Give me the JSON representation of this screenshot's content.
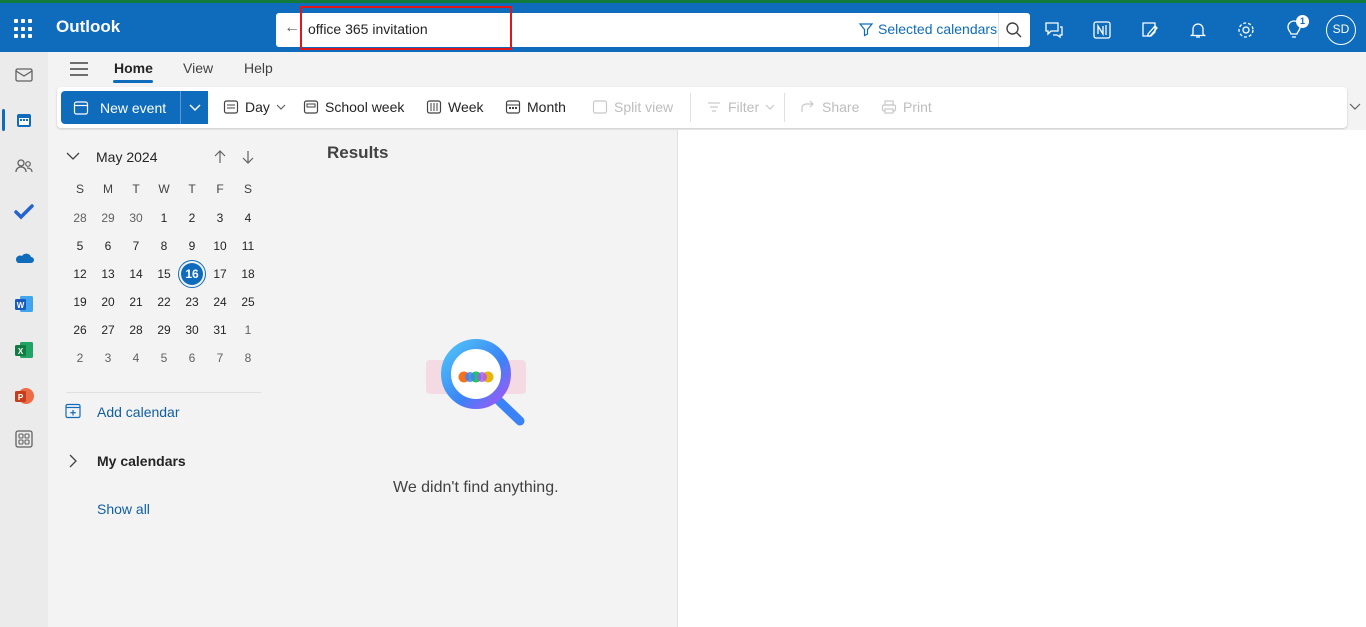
{
  "app": {
    "name": "Outlook",
    "brand_color": "#0f6cbd"
  },
  "search": {
    "query": "office 365 invitation",
    "scope": "Selected calendars"
  },
  "header": {
    "notification_count": "1",
    "avatar_initials": "SD",
    "icons": [
      "chat-icon",
      "onenote-icon",
      "todo-icon",
      "bell-icon",
      "gear-icon",
      "lightbulb-icon"
    ]
  },
  "rail": {
    "items": [
      "mail-icon",
      "calendar-icon",
      "people-icon",
      "todo-check-icon",
      "onedrive-icon",
      "word-icon",
      "excel-icon",
      "powerpoint-icon",
      "apps-icon"
    ]
  },
  "ribbon": {
    "tabs": [
      "Home",
      "View",
      "Help"
    ],
    "active_tab": "Home"
  },
  "commands": {
    "new_event": "New event",
    "day": "Day",
    "school_week": "School week",
    "week": "Week",
    "month": "Month",
    "split_view": "Split view",
    "filter": "Filter",
    "share": "Share",
    "print": "Print"
  },
  "mini_calendar": {
    "month_label": "May 2024",
    "weekdays": [
      "S",
      "M",
      "T",
      "W",
      "T",
      "F",
      "S"
    ],
    "weeks": [
      [
        "28",
        "29",
        "30",
        "1",
        "2",
        "3",
        "4"
      ],
      [
        "5",
        "6",
        "7",
        "8",
        "9",
        "10",
        "11"
      ],
      [
        "12",
        "13",
        "14",
        "15",
        "16",
        "17",
        "18"
      ],
      [
        "19",
        "20",
        "21",
        "22",
        "23",
        "24",
        "25"
      ],
      [
        "26",
        "27",
        "28",
        "29",
        "30",
        "31",
        "1"
      ],
      [
        "2",
        "3",
        "4",
        "5",
        "6",
        "7",
        "8"
      ]
    ],
    "today": "16"
  },
  "sidebar": {
    "add_calendar": "Add calendar",
    "my_calendars": "My calendars",
    "show_all": "Show all"
  },
  "results": {
    "title": "Results",
    "empty_message": "We didn't find anything."
  }
}
